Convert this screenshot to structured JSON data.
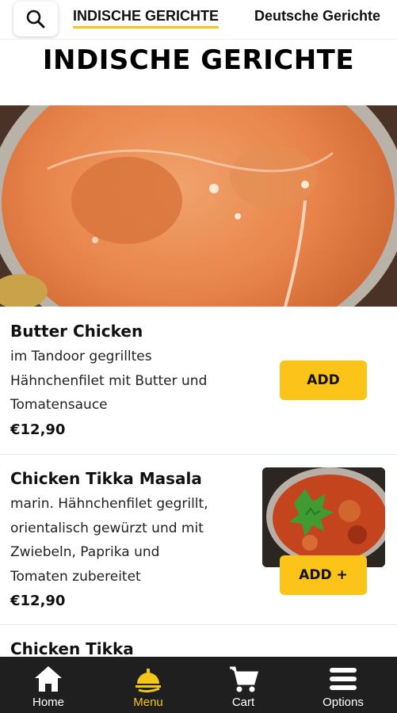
{
  "tabs": {
    "active": "INDISCHE GERICHTE",
    "other": "Deutsche Gerichte"
  },
  "section_title": "INDISCHE GERICHTE",
  "items": [
    {
      "name": "Butter Chicken",
      "description_lines": [
        "im Tandoor gegrilltes",
        "Hähnchenfilet mit Butter und",
        "Tomatensauce"
      ],
      "price": "€12,90",
      "button": "ADD"
    },
    {
      "name": "Chicken Tikka Masala",
      "description_lines": [
        "marin. Hähnchenfilet gegrillt,",
        "orientalisch gewürzt und mit",
        "Zwiebeln, Paprika und",
        "Tomaten zubereitet"
      ],
      "price": "€12,90",
      "button": "ADD +"
    },
    {
      "name": "Chicken Tikka"
    }
  ],
  "nav": {
    "home": "Home",
    "menu": "Menu",
    "cart": "Cart",
    "options": "Options"
  },
  "icons": {
    "search": "search-icon",
    "home": "home-icon",
    "menu": "menu-dish-icon",
    "cart": "cart-icon",
    "options": "hamburger-icon"
  },
  "colors": {
    "accent": "#fcc419",
    "nav_background": "#1f1f1f",
    "active_nav_text": "#f5c518"
  }
}
